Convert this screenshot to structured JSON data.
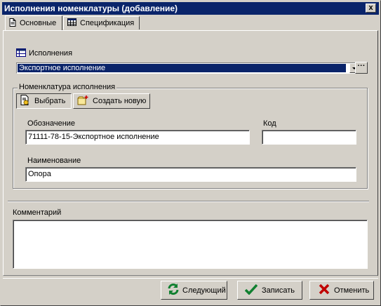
{
  "window": {
    "title": "Исполнения номенклатуры (добавление)",
    "close_label": "x"
  },
  "tabs": [
    {
      "label": "Основные",
      "active": true
    },
    {
      "label": "Спецификация",
      "active": false
    }
  ],
  "executions": {
    "label": "Исполнения",
    "selected_value": "Экспортное исполнение",
    "ellipsis_label": "···"
  },
  "nomenclature_group": {
    "title": "Номенклатура исполнения",
    "select_button": "Выбрать",
    "create_button": "Создать новую",
    "designation_label": "Обозначение",
    "designation_value": "71111-78-15-Экспортное исполнение",
    "code_label": "Код",
    "code_value": "",
    "name_label": "Наименование",
    "name_value": "Опора"
  },
  "comment": {
    "label": "Комментарий",
    "value": ""
  },
  "footer": {
    "next_button": "Следующий",
    "save_button": "Записать",
    "cancel_button": "Отменить"
  },
  "colors": {
    "titlebar": "#0a246a",
    "face": "#d4d0c8",
    "selection": "#0a246a"
  }
}
